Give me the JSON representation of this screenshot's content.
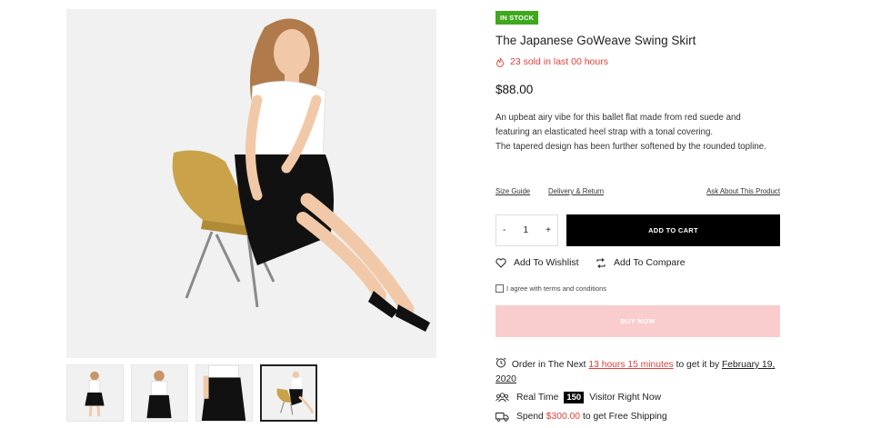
{
  "product": {
    "stock_badge": "IN STOCK",
    "title": "The Japanese GoWeave Swing Skirt",
    "sold_text": "23 sold in last 00 hours",
    "price": "$88.00",
    "description_lines": [
      "An upbeat airy vibe for this ballet flat made from red suede and featuring an elasticated heel strap with a tonal covering.",
      "The tapered design has been further softened by the rounded topline."
    ]
  },
  "links": {
    "size_guide": "Size Guide",
    "delivery_return": "Delivery & Return",
    "ask_about": "Ask About This Product"
  },
  "purchase": {
    "qty_minus": "-",
    "qty_value": "1",
    "qty_plus": "+",
    "add_to_cart": "ADD TO CART",
    "wishlist": "Add To Wishlist",
    "compare": "Add To Compare",
    "terms": "I agree with terms and conditions",
    "buy_now": "BUY NOW"
  },
  "delivery": {
    "order_prefix": "Order in The Next",
    "order_time": "13 hours 15 minutes",
    "order_mid": "to get it by",
    "order_date": "February 19, 2020",
    "visitors_prefix": "Real Time",
    "visitors_count": "150",
    "visitors_suffix": "Visitor Right Now",
    "shipping_prefix": "Spend",
    "shipping_amount": "$300.00",
    "shipping_suffix": "to get Free Shipping"
  },
  "gallery": {
    "thumbnail_count": 4,
    "active_thumbnail": 4
  },
  "colors": {
    "in_stock": "#3fa81d",
    "accent_red": "#e0403b",
    "buy_now_bg": "#f9ccce",
    "add_to_cart_bg": "#000000"
  }
}
